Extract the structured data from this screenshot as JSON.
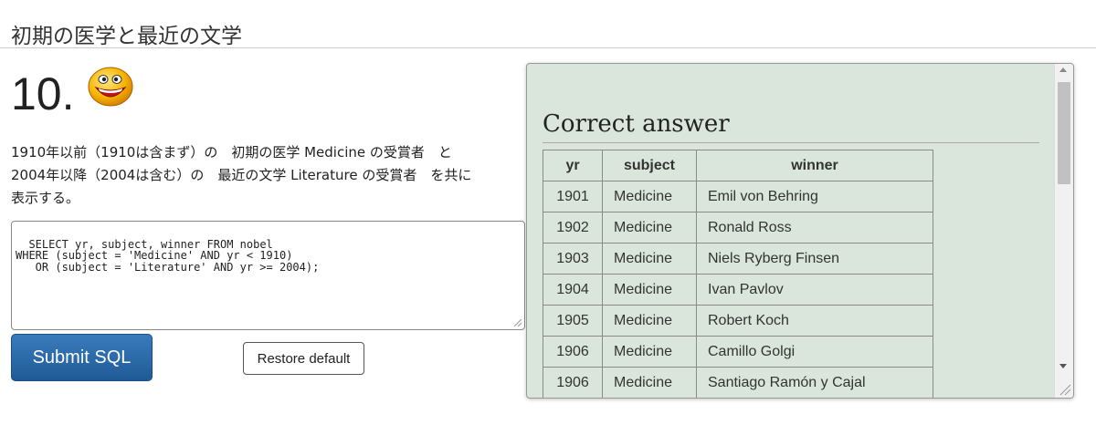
{
  "page": {
    "title": "初期の医学と最近の文学"
  },
  "question": {
    "number": "10.",
    "text_line1": "1910年以前（1910は含まず）の　初期の医学 Medicine の受賞者　と",
    "text_line2": "2004年以降（2004は含む）の　最近の文学 Literature の受賞者　を共に",
    "text_line3": "表示する。",
    "icon": "smiley-icon"
  },
  "editor": {
    "value": "SELECT yr, subject, winner FROM nobel\nWHERE (subject = 'Medicine' AND yr < 1910)\n   OR (subject = 'Literature' AND yr >= 2004);"
  },
  "buttons": {
    "submit_label": "Submit SQL",
    "restore_label": "Restore default"
  },
  "answer": {
    "heading": "Correct answer",
    "columns": [
      "yr",
      "subject",
      "winner"
    ],
    "rows": [
      [
        "1901",
        "Medicine",
        "Emil von Behring"
      ],
      [
        "1902",
        "Medicine",
        "Ronald Ross"
      ],
      [
        "1903",
        "Medicine",
        "Niels Ryberg Finsen"
      ],
      [
        "1904",
        "Medicine",
        "Ivan Pavlov"
      ],
      [
        "1905",
        "Medicine",
        "Robert Koch"
      ],
      [
        "1906",
        "Medicine",
        "Camillo Golgi"
      ],
      [
        "1906",
        "Medicine",
        "Santiago Ramón y Cajal"
      ]
    ]
  },
  "colors": {
    "panel_bg": "#dae6db",
    "submit_bg": "#2a6aab",
    "text": "#222222"
  }
}
